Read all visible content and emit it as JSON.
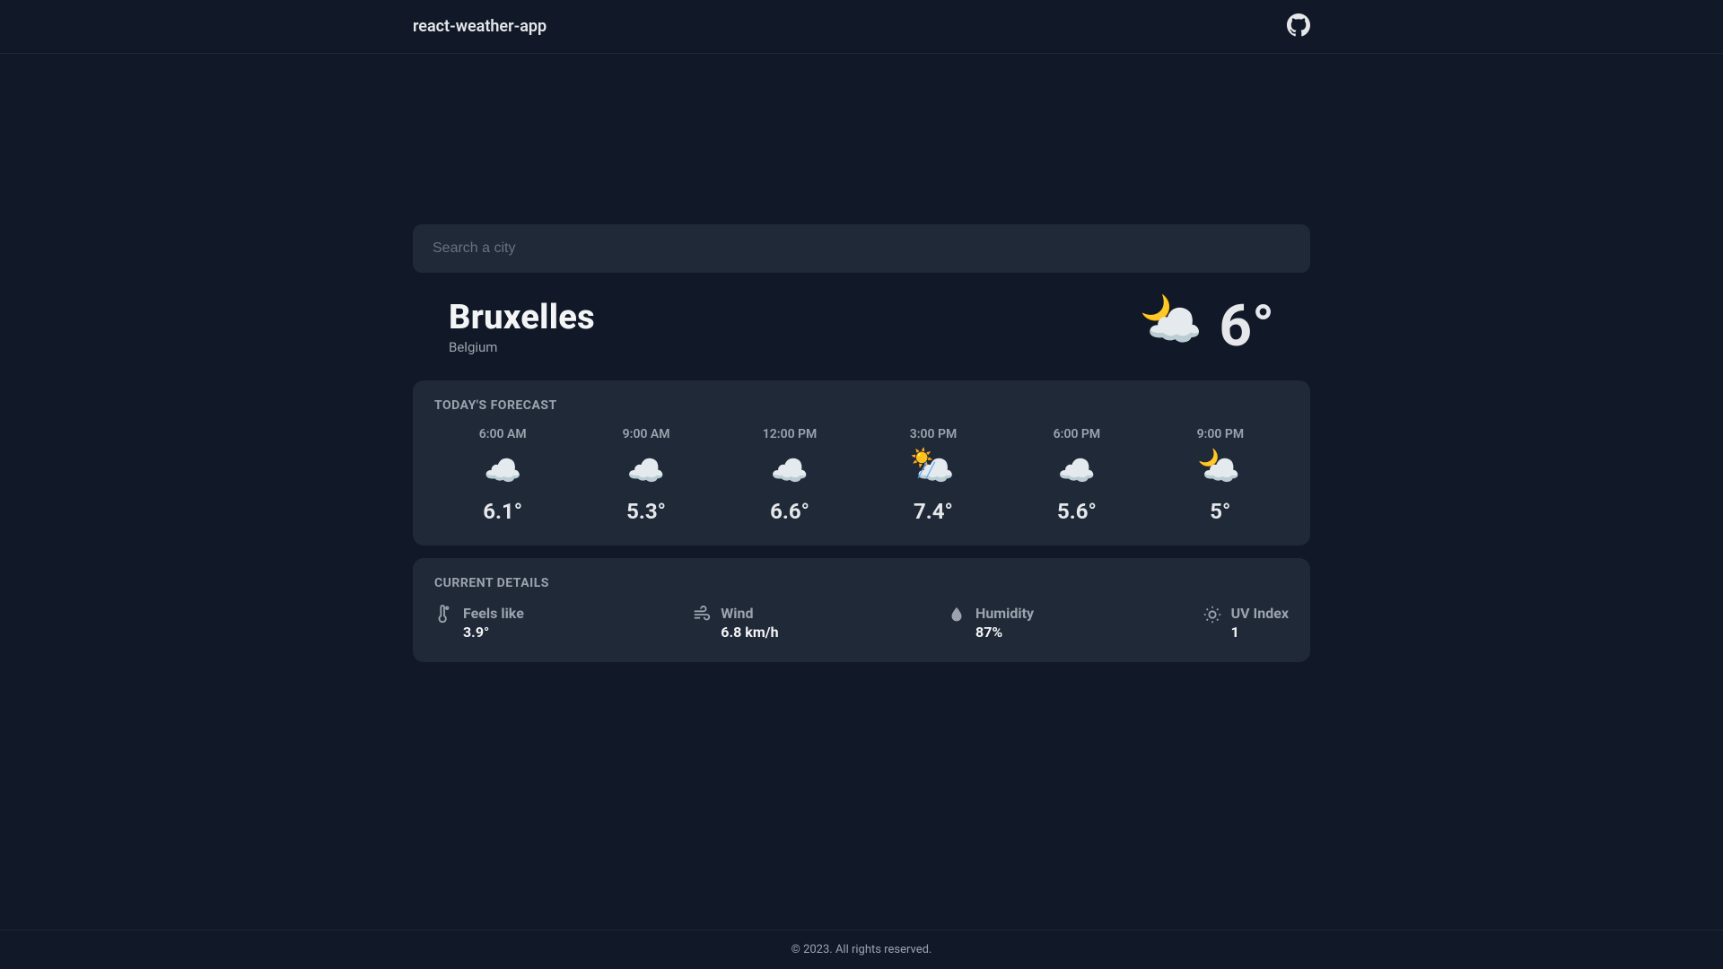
{
  "header": {
    "title": "react-weather-app",
    "github_icon": "github-icon"
  },
  "search": {
    "placeholder": "Search a city",
    "value": ""
  },
  "current": {
    "city": "Bruxelles",
    "country": "Belgium",
    "temp": "6°",
    "condition_icon": "partly-cloudy-night"
  },
  "forecast": {
    "title": "TODAY'S FORECAST",
    "items": [
      {
        "time": "6:00 AM",
        "icon": "cloudy",
        "temp": "6.1°"
      },
      {
        "time": "9:00 AM",
        "icon": "cloudy",
        "temp": "5.3°"
      },
      {
        "time": "12:00 PM",
        "icon": "cloudy",
        "temp": "6.6°"
      },
      {
        "time": "3:00 PM",
        "icon": "partly-sunny-showers",
        "temp": "7.4°"
      },
      {
        "time": "6:00 PM",
        "icon": "cloudy",
        "temp": "5.6°"
      },
      {
        "time": "9:00 PM",
        "icon": "partly-cloudy-night",
        "temp": "5°"
      }
    ]
  },
  "details": {
    "title": "CURRENT DETAILS",
    "feels_like": {
      "label": "Feels like",
      "value": "3.9°"
    },
    "wind": {
      "label": "Wind",
      "value": "6.8 km/h"
    },
    "humidity": {
      "label": "Humidity",
      "value": "87%"
    },
    "uv": {
      "label": "UV Index",
      "value": "1"
    }
  },
  "footer": {
    "text": "© 2023. All rights reserved."
  }
}
